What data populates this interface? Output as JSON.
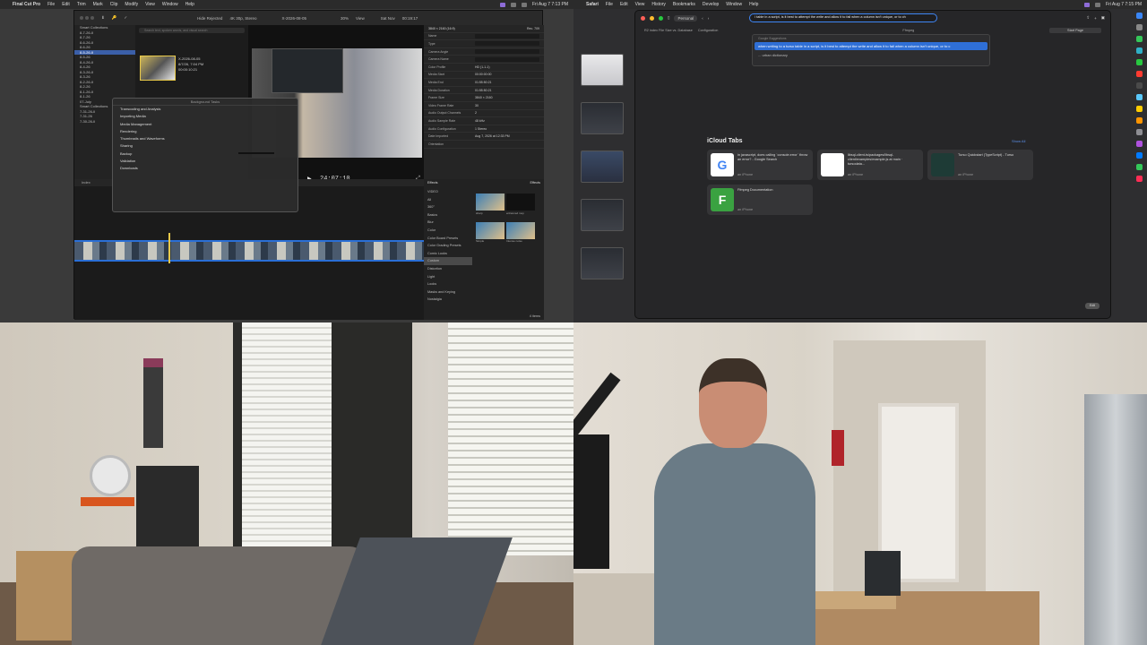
{
  "left_screen": {
    "menubar": {
      "app": "Final Cut Pro",
      "items": [
        "File",
        "Edit",
        "Trim",
        "Mark",
        "Clip",
        "Modify",
        "View",
        "Window",
        "Help"
      ],
      "datetime": "Fri Aug 7  7:13 PM"
    },
    "fcp": {
      "toolbar": {
        "filter": "Hide Rejected",
        "format": "4K 30p, Stereo",
        "clip_name": "X-2026-08-05",
        "zoom": "30%",
        "view": "View",
        "inspector_header": "Sat Nov",
        "inspector_time": "00:19:17"
      },
      "sidebar_rows": [
        "Smart Collections",
        "8-7-26-II",
        "8-7-26",
        "8-6-26-II",
        "8-6-26",
        "8-5-26-II",
        "8-5-26",
        "8-4-26-II",
        "8-4-26",
        "8-3-26-II",
        "8-3-26",
        "8-2-26-II",
        "8-2-26",
        "8-1-26-II",
        "8-1-26",
        "07-July",
        "Smart Collections",
        "7-31-26-II",
        "7-31-26",
        "7-30-26-II"
      ],
      "search_placeholder": "Search text, spoken words, and visual search",
      "clip": {
        "name": "X-2026-08-05",
        "date": "8/7/26, 7:04 PM",
        "duration": "00:00:10:21"
      },
      "background_tasks": {
        "title": "Background Tasks",
        "items": [
          "Transcoding and Analysis",
          "Importing Media",
          "Media Management",
          "Rendering",
          "Thumbnails and Waveforms",
          "Sharing",
          "Backup",
          "Validation",
          "Downloads"
        ]
      },
      "timecode": "24:07:10",
      "inspector": {
        "title": "3840 × 2160 (16:9)",
        "subtitle": "Rec. 709",
        "rows": [
          {
            "k": "Name",
            "v": ""
          },
          {
            "k": "Type",
            "v": ""
          },
          {
            "k": "Camera Angle",
            "v": ""
          },
          {
            "k": "Camera Name",
            "v": ""
          },
          {
            "k": "Color Profile",
            "v": "HD (1-1-1)"
          },
          {
            "k": "Media Start",
            "v": "00:00:00:00"
          },
          {
            "k": "Media End",
            "v": "01:55:50:21"
          },
          {
            "k": "Media Duration",
            "v": "01:55:50:21"
          },
          {
            "k": "Frame Size",
            "v": "3840 × 2160"
          },
          {
            "k": "Video Frame Rate",
            "v": "30"
          },
          {
            "k": "Audio Output Channels",
            "v": "2"
          },
          {
            "k": "Audio Sample Rate",
            "v": "48 kHz"
          },
          {
            "k": "Audio Configuration",
            "v": "1 Stereo"
          },
          {
            "k": "Date Imported",
            "v": "Aug 7, 2026 at 12:33 PM"
          },
          {
            "k": "Orientation",
            "v": ""
          }
        ],
        "btn_general": "General",
        "btn_apply": "Apply Custom Name"
      },
      "timeline_label": "Index",
      "effects": {
        "title": "Effects",
        "title_right": "Effects",
        "categories": [
          "VIDEO",
          "All",
          "360°",
          "Basics",
          "Blur",
          "Color",
          "Color Board Presets",
          "Color Grading Presets",
          "Comic Looks",
          "Custom",
          "Distortion",
          "Light",
          "Looks",
          "Masks and Keying",
          "Nostalgia"
        ],
        "selected": "Custom",
        "tiles": [
          "sharp",
          "enhanced mop",
          "Simple",
          "Intense noise"
        ],
        "count": "4 items"
      }
    }
  },
  "right_screen": {
    "menubar": {
      "app": "Safari",
      "items": [
        "File",
        "Edit",
        "View",
        "History",
        "Bookmarks",
        "Develop",
        "Window",
        "Help"
      ],
      "datetime": "Fri Aug 7  7:15 PM"
    },
    "safari": {
      "profile": "Personal",
      "address": "l table in a script, is it best to attempt the write and allow it to fail when a column isn't unique, or to ch",
      "favorites": [
        "R2 index File Size vs. Database",
        "Configuration",
        "Ffmpeg"
      ],
      "start_page": "Start Page",
      "suggestions": {
        "header": "Google Suggestions",
        "highlighted": "when writing to a turso table in a script, is it best to attempt the write and allow it to fail when a column isn't unique, or to c",
        "other": "... urban dictionary"
      },
      "icloud_title": "iCloud Tabs",
      "show_all": "Show All",
      "cards": [
        {
          "title": "in javascript, does calling `console.error` throw an error? - Google Search",
          "source": "google.com",
          "device": "an iPhone",
          "icon": "G"
        },
        {
          "title": "libsql-client-ts/packages/libsql-client/examples/example.js at main · tursodata...",
          "source": "github.com",
          "device": "an iPhone",
          "icon": ""
        },
        {
          "title": "Turso Quickstart (TypeScript) - Turso",
          "source": "docs.turso.tech",
          "device": "an iPhone",
          "icon": ""
        },
        {
          "title": "Ffmpeg Documentation",
          "source": "ffmpeg.org",
          "device": "an iPhone",
          "icon": "F"
        }
      ],
      "edit": "Edit"
    }
  },
  "colors": {
    "accent_blue": "#3f86f5",
    "fcp_selection": "#3b5fa8",
    "clip_outline": "#e8c94a"
  }
}
